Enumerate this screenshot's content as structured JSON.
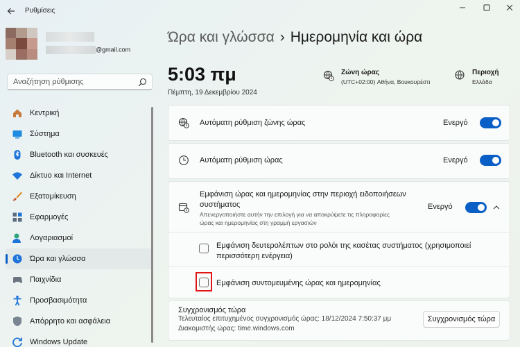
{
  "window": {
    "title": "Ρυθμίσεις"
  },
  "profile": {
    "email": "@gmail.com"
  },
  "search": {
    "placeholder": "Αναζήτηση ρύθμισης"
  },
  "nav": {
    "items": [
      {
        "label": "Κεντρική",
        "icon": "home-icon"
      },
      {
        "label": "Σύστημα",
        "icon": "system-icon"
      },
      {
        "label": "Bluetooth και συσκευές",
        "icon": "bluetooth-icon"
      },
      {
        "label": "Δίκτυο και Internet",
        "icon": "wifi-icon"
      },
      {
        "label": "Εξατομίκευση",
        "icon": "brush-icon"
      },
      {
        "label": "Εφαρμογές",
        "icon": "apps-icon"
      },
      {
        "label": "Λογαριασμοί",
        "icon": "account-icon"
      },
      {
        "label": "Ώρα και γλώσσα",
        "icon": "time-language-icon",
        "active": true
      },
      {
        "label": "Παιχνίδια",
        "icon": "gamepad-icon"
      },
      {
        "label": "Προσβασιμότητα",
        "icon": "accessibility-icon"
      },
      {
        "label": "Απόρρητο και ασφάλεια",
        "icon": "shield-icon"
      },
      {
        "label": "Windows Update",
        "icon": "update-icon"
      }
    ]
  },
  "header": {
    "parent": "Ώρα και γλώσσα",
    "separator": "›",
    "current": "Ημερομηνία και ώρα"
  },
  "clock": {
    "time": "5:03 πμ",
    "date": "Πέμπτη, 19 Δεκεμβρίου 2024"
  },
  "timezone": {
    "title": "Ζώνη ώρας",
    "value": "(UTC+02:00) Αθήνα, Βουκουρέστι"
  },
  "region": {
    "title": "Περιοχή",
    "value": "Ελλάδα"
  },
  "settings": {
    "auto_timezone": {
      "label": "Αυτόματη ρύθμιση ζώνης ώρας",
      "state": "Ενεργό",
      "on": true
    },
    "auto_time": {
      "label": "Αυτόματη ρύθμιση ώρας",
      "state": "Ενεργό",
      "on": true
    },
    "tray_display": {
      "label_line1": "Εμφάνιση ώρας και ημερομηνίας στην περιοχή ειδοποιήσεων",
      "label_line2": "συστήματος",
      "desc_line1": "Απενεργοποιήστε αυτήν την επιλογή για να αποκρύψετε τις πληροφορίες",
      "desc_line2": "ώρας και ημερομηνίας στη γραμμή εργασιών",
      "state": "Ενεργό",
      "on": true
    },
    "show_seconds": {
      "label_line1": "Εμφάνιση δευτερολέπτων στο ρολόι της κασέτας συστήματος (χρησιμοποιεί",
      "label_line2": "περισσότερη ενέργεια)",
      "checked": false
    },
    "short_datetime": {
      "label": "Εμφάνιση συντομευμένης ώρας και ημερομηνίας",
      "checked": false
    }
  },
  "sync": {
    "title": "Συγχρονισμός τώρα",
    "last_sync": "Τελευταίος επιτυχημένος συγχρονισμός ώρας: 18/12/2024 7:50:37 μμ",
    "server": "Διακομιστής ώρας: time.windows.com",
    "button": "Συγχρονισμός τώρα"
  },
  "colors": {
    "accent": "#0a5fc7",
    "highlight": "#e01515"
  }
}
